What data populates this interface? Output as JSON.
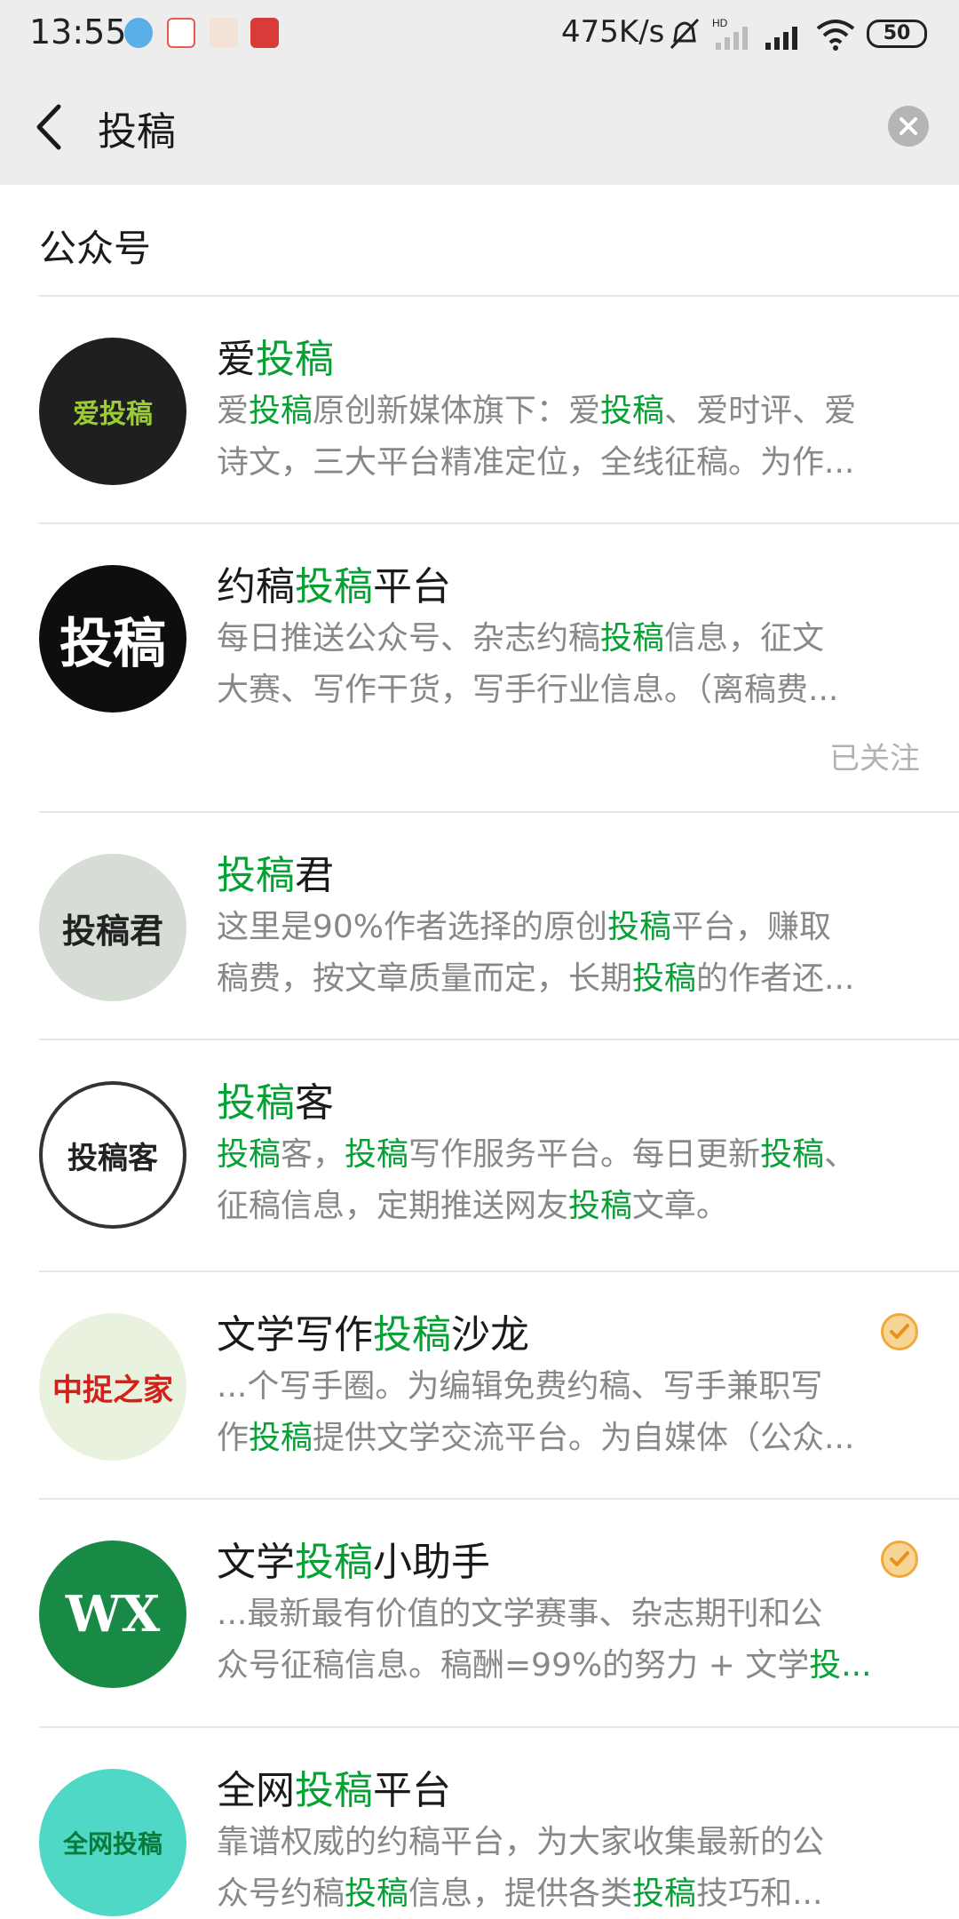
{
  "status_bar": {
    "time": "13:55",
    "speed": "475K/s",
    "battery": "50"
  },
  "search": {
    "query": "投稿"
  },
  "section": {
    "title": "公众号"
  },
  "results": [
    {
      "name_parts": [
        [
          "爱",
          0
        ],
        [
          "投稿",
          1
        ]
      ],
      "desc_lines": [
        [
          [
            "爱",
            0
          ],
          [
            "投稿",
            1
          ],
          [
            "原创新媒体旗下：爱",
            0
          ],
          [
            "投稿",
            1
          ],
          [
            "、爱时评、爱",
            0
          ]
        ],
        [
          [
            "诗文，三大平台精准定位，全线征稿。为作...",
            0
          ]
        ]
      ],
      "followed": "",
      "verified": false,
      "avatar": "爱投稿"
    },
    {
      "name_parts": [
        [
          "约稿",
          0
        ],
        [
          "投稿",
          1
        ],
        [
          "平台",
          0
        ]
      ],
      "desc_lines": [
        [
          [
            "每日推送公众号、杂志约稿",
            0
          ],
          [
            "投稿",
            1
          ],
          [
            "信息，征文",
            0
          ]
        ],
        [
          [
            "大赛、写作干货，写手行业信息。（离稿费...",
            0
          ]
        ]
      ],
      "followed": "已关注",
      "verified": false,
      "avatar": "投稿"
    },
    {
      "name_parts": [
        [
          "投稿",
          1
        ],
        [
          "君",
          0
        ]
      ],
      "desc_lines": [
        [
          [
            "这里是90%作者选择的原创",
            0
          ],
          [
            "投稿",
            1
          ],
          [
            "平台，赚取",
            0
          ]
        ],
        [
          [
            "稿费，按文章质量而定，长期",
            0
          ],
          [
            "投稿",
            1
          ],
          [
            "的作者还...",
            0
          ]
        ]
      ],
      "followed": "",
      "verified": false,
      "avatar": "投稿君"
    },
    {
      "name_parts": [
        [
          "投稿",
          1
        ],
        [
          "客",
          0
        ]
      ],
      "desc_lines": [
        [
          [
            "投稿",
            1
          ],
          [
            "客，",
            0
          ],
          [
            "投稿",
            1
          ],
          [
            "写作服务平台。每日更新",
            0
          ],
          [
            "投稿",
            1
          ],
          [
            "、",
            0
          ]
        ],
        [
          [
            "征稿信息，定期推送网友",
            0
          ],
          [
            "投稿",
            1
          ],
          [
            "文章。",
            0
          ]
        ]
      ],
      "followed": "",
      "verified": false,
      "avatar": "投稿客"
    },
    {
      "name_parts": [
        [
          "文学写作",
          0
        ],
        [
          "投稿",
          1
        ],
        [
          "沙龙",
          0
        ]
      ],
      "desc_lines": [
        [
          [
            "...个写手圈。为编辑免费约稿、写手兼职写",
            0
          ]
        ],
        [
          [
            "作",
            0
          ],
          [
            "投稿",
            1
          ],
          [
            "提供文学交流平台。为自媒体（公众...",
            0
          ]
        ]
      ],
      "followed": "",
      "verified": true,
      "avatar": "中捉之家"
    },
    {
      "name_parts": [
        [
          "文学",
          0
        ],
        [
          "投稿",
          1
        ],
        [
          "小助手",
          0
        ]
      ],
      "desc_lines": [
        [
          [
            "...最新最有价值的文学赛事、杂志期刊和公",
            0
          ]
        ],
        [
          [
            "众号征稿信息。稿酬=99%的努力 + 文学",
            0
          ],
          [
            "投...",
            1
          ]
        ]
      ],
      "followed": "",
      "verified": true,
      "avatar": "WX"
    },
    {
      "name_parts": [
        [
          "全网",
          0
        ],
        [
          "投稿",
          1
        ],
        [
          "平台",
          0
        ]
      ],
      "desc_lines": [
        [
          [
            "靠谱权威的约稿平台，为大家收集最新的公",
            0
          ]
        ],
        [
          [
            "众号约稿",
            0
          ],
          [
            "投稿",
            1
          ],
          [
            "信息，提供各类",
            0
          ],
          [
            "投稿",
            1
          ],
          [
            "技巧和...",
            0
          ]
        ]
      ],
      "followed": "",
      "verified": false,
      "avatar": "全网投稿"
    }
  ],
  "colors": {
    "highlight": "#07a034",
    "header_bg": "#ededed"
  }
}
